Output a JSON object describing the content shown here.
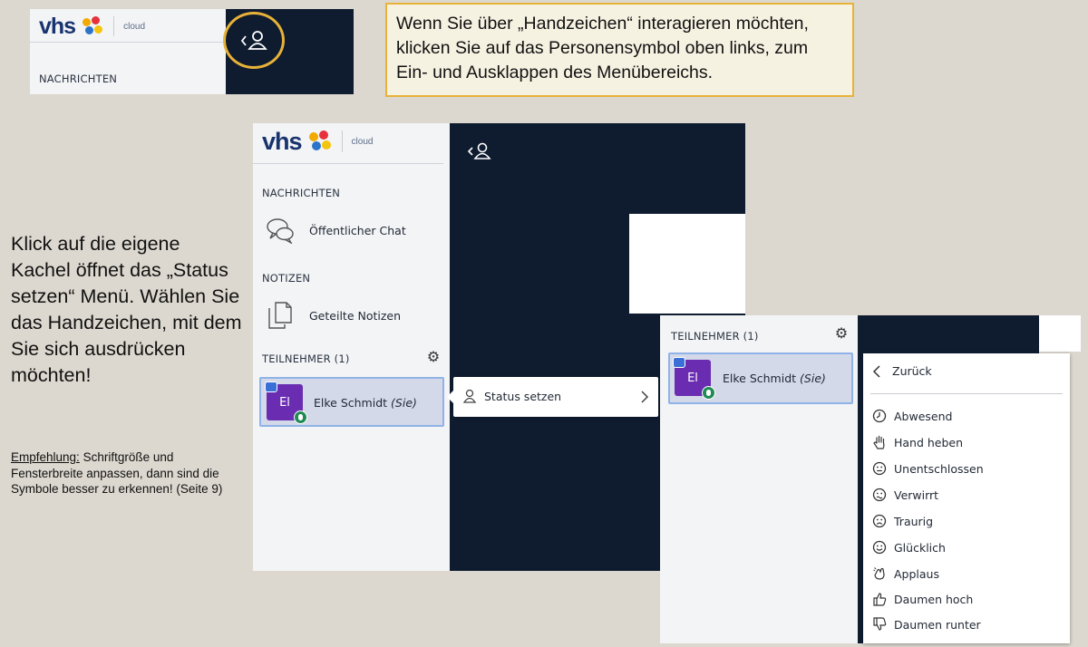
{
  "logo": {
    "text": "vhs",
    "cloud": "cloud"
  },
  "sections": {
    "messages": "NACHRICHTEN",
    "notes": "NOTIZEN",
    "participants": "TEILNEHMER (1)"
  },
  "callout": {
    "text": "Wenn Sie über „Handzeichen“ interagieren möchten, klicken Sie auf das Personensymbol oben links, zum Ein- und Ausklappen des Menübereichs."
  },
  "sidebar": {
    "public_chat": "Öffentlicher Chat",
    "shared_notes": "Geteilte Notizen"
  },
  "user": {
    "initials": "El",
    "name": "Elke Schmidt",
    "suffix": "(Sie)"
  },
  "status_popup": {
    "label": "Status setzen"
  },
  "instructions": {
    "main": "Klick auf die eigene Kachel öffnet das „Status setzen“ Menü. Wählen Sie das Handzeichen, mit dem Sie sich ausdrücken möchten!",
    "tip_label": "Empfehlung:",
    "tip_text": " Schriftgröße und Fensterbreite anpassen, dann sind die Symbole besser zu erkennen! (Seite 9)"
  },
  "status_menu": {
    "back": "Zurück",
    "items": [
      {
        "label": "Abwesend",
        "icon": "clock-icon"
      },
      {
        "label": "Hand heben",
        "icon": "hand-icon"
      },
      {
        "label": "Unentschlossen",
        "icon": "neutral-face-icon"
      },
      {
        "label": "Verwirrt",
        "icon": "confused-face-icon"
      },
      {
        "label": "Traurig",
        "icon": "sad-face-icon"
      },
      {
        "label": "Glücklich",
        "icon": "happy-face-icon"
      },
      {
        "label": "Applaus",
        "icon": "applause-icon"
      },
      {
        "label": "Daumen hoch",
        "icon": "thumbs-up-icon"
      },
      {
        "label": "Daumen runter",
        "icon": "thumbs-down-icon"
      }
    ]
  },
  "colors": {
    "background": "#dcd8cf",
    "dark_area": "#0f1c30",
    "highlight_ring": "#e8b238",
    "avatar": "#6a2db1"
  }
}
